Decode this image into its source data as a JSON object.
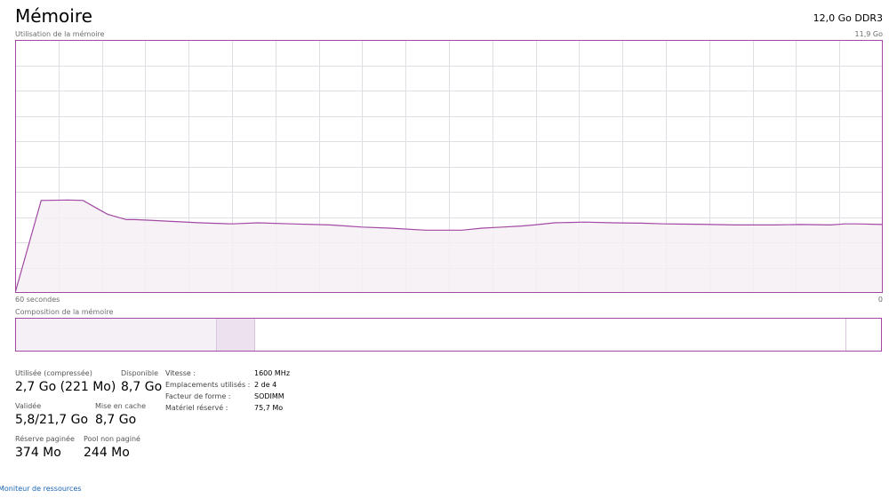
{
  "header": {
    "title": "Mémoire",
    "total": "12,0 Go DDR3"
  },
  "chart": {
    "label": "Utilisation de la mémoire",
    "max_label": "11,9 Go",
    "time_left": "60 secondes",
    "time_right": "0",
    "line_color": "#a349a4",
    "fill_color": "#f4f0f5",
    "grid_color": "#e2dde4"
  },
  "chart_data": {
    "type": "area",
    "xlabel": "60 secondes",
    "ylabel": "Utilisation de la mémoire",
    "xlim": [
      60,
      0
    ],
    "ylim": [
      0,
      11.9
    ],
    "grid": true,
    "x": [
      60,
      58.2,
      56.3,
      55.3,
      54.4,
      53.6,
      52.3,
      51.7,
      50.7,
      49.5,
      47.2,
      45.0,
      43.2,
      40.9,
      38.2,
      36.0,
      34.1,
      31.6,
      29.1,
      27.7,
      26.3,
      25.0,
      24.1,
      22.7,
      20.6,
      18.6,
      16.7,
      15.1,
      12.7,
      10.2,
      7.5,
      5.7,
      3.6,
      2.6,
      1.8,
      0
    ],
    "series": [
      {
        "values": [
          0,
          4.35,
          4.37,
          4.35,
          4.0,
          3.7,
          3.45,
          3.45,
          3.42,
          3.38,
          3.3,
          3.25,
          3.3,
          3.25,
          3.2,
          3.1,
          3.05,
          2.95,
          2.95,
          3.05,
          3.1,
          3.15,
          3.2,
          3.3,
          3.33,
          3.3,
          3.28,
          3.25,
          3.23,
          3.2,
          3.2,
          3.22,
          3.2,
          3.25,
          3.25,
          3.22
        ]
      }
    ]
  },
  "composition": {
    "label": "Composition de la mémoire"
  },
  "stats": {
    "used_label": "Utilisée (compressée)",
    "used_value": "2,7 Go (221 Mo)",
    "available_label": "Disponible",
    "available_value": "8,7 Go",
    "committed_label": "Validée",
    "committed_value": "5,8/21,7 Go",
    "cached_label": "Mise en cache",
    "cached_value": "8,7 Go",
    "paged_label": "Réserve paginée",
    "paged_value": "374 Mo",
    "nonpaged_label": "Pool non paginé",
    "nonpaged_value": "244 Mo"
  },
  "info": [
    {
      "label": "Vitesse :",
      "value": "1600 MHz"
    },
    {
      "label": "Emplacements utilisés :",
      "value": "2 de 4"
    },
    {
      "label": "Facteur de forme :",
      "value": "SODIMM"
    },
    {
      "label": "Matériel réservé :",
      "value": "75,7 Mo"
    }
  ],
  "footer": {
    "link": "Moniteur de ressources"
  }
}
